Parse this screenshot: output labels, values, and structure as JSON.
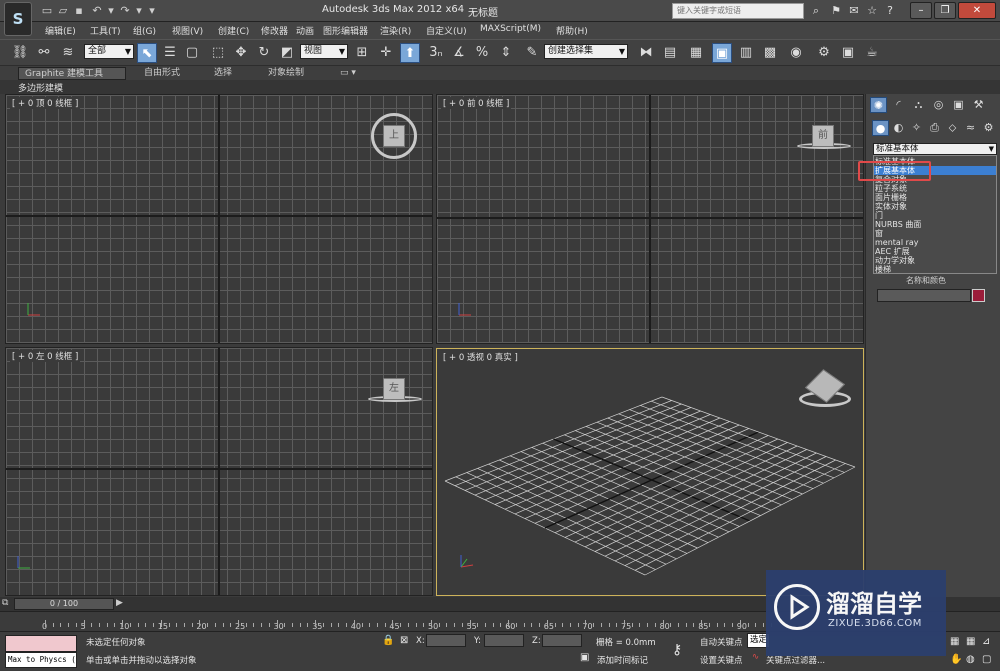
{
  "titlebar": {
    "title": "Autodesk 3ds Max  2012 x64",
    "subtitle": "无标题",
    "search_placeholder": "键入关键字或短语"
  },
  "menu": [
    "编辑(E)",
    "工具(T)",
    "组(G)",
    "视图(V)",
    "创建(C)",
    "修改器",
    "动画",
    "图形编辑器",
    "渲染(R)",
    "自定义(U)",
    "MAXScript(M)",
    "帮助(H)"
  ],
  "toolbar": {
    "selection_filter": "全部",
    "ref_coord": "视图",
    "named_selection": "创建选择集"
  },
  "ribbon": {
    "tabs": [
      "Graphite 建模工具",
      "自由形式",
      "选择",
      "对象绘制"
    ],
    "sub_label": "多边形建模"
  },
  "viewports": {
    "top": {
      "label": "[ + 0 顶 0 线框 ]",
      "cube": "上"
    },
    "front": {
      "label": "[ + 0 前 0 线框 ]",
      "cube": "前"
    },
    "left": {
      "label": "[ + 0 左 0 线框 ]",
      "cube": "左"
    },
    "perspective": {
      "label": "[ + 0 透视 0 真实 ]"
    }
  },
  "command_panel": {
    "dropdown_value": "标准基本体",
    "options": [
      "标准基本体",
      "扩展基本体",
      "复合对象",
      "粒子系统",
      "面片栅格",
      "实体对象",
      "门",
      "NURBS 曲面",
      "窗",
      "mental ray",
      "AEC 扩展",
      "动力学对象",
      "楼梯"
    ],
    "selected_index": 1,
    "name_color_label": "名称和颜色"
  },
  "timeline": {
    "position": "0 / 100",
    "ticks": [
      "0",
      "5",
      "10",
      "15",
      "20",
      "25",
      "30",
      "35",
      "40",
      "45",
      "50",
      "55",
      "60",
      "65",
      "70",
      "75",
      "80",
      "85",
      "90"
    ]
  },
  "status": {
    "maxscript_output": "Max to Physcs (",
    "selection_status": "未选定任何对象",
    "prompt": "单击或单击并拖动以选择对象",
    "x_label": "X:",
    "y_label": "Y:",
    "z_label": "Z:",
    "grid": "栅格 = 0.0mm",
    "auto_key": "自动关键点",
    "selected_btn": "选定",
    "set_key": "设置关键点",
    "key_filters": "关键点过滤器...",
    "add_time_tag": "添加时间标记"
  },
  "watermark": {
    "title": "溜溜自学",
    "url": "ZIXUE.3D66.COM"
  },
  "colors": {
    "accent_selected": "#3c7fd2",
    "highlight_box": "#e04a4a",
    "active_viewport_border": "#cdb35a",
    "object_color": "#9b1d3a"
  }
}
